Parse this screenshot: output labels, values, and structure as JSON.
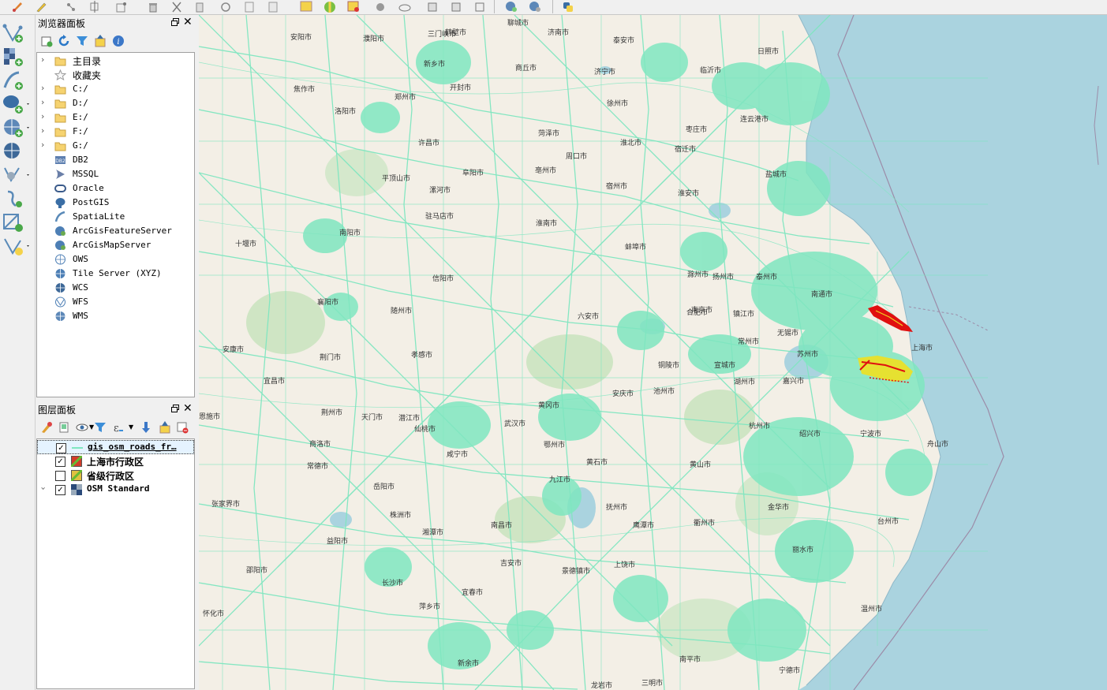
{
  "app": {
    "accent": "#7fe6c0"
  },
  "top_toolbar": {
    "icons": [
      "pencil-edit-icon",
      "pencil-icon",
      "add-feature-icon",
      "move-feature-icon",
      "node-tool-icon",
      "delete-icon",
      "cut-icon",
      "copy-icon",
      "paste-icon",
      "label-icon",
      "pie-diagram-icon",
      "layer-style-icon",
      "pin-icon",
      "show-tips-icon",
      "export-icon",
      "save-icon",
      "refresh-icon",
      "identify-icon",
      "measure-icon",
      "python-icon"
    ]
  },
  "left_toolbar": {
    "icons": [
      "add-vector-layer-icon",
      "add-raster-layer-icon",
      "add-delimited-text-icon",
      "add-postgis-icon",
      "add-wms-icon",
      "add-wcs-icon",
      "add-spatialite-icon",
      "new-temp-layer-icon",
      "add-virtual-layer-icon",
      "add-mesh-icon"
    ]
  },
  "browser_panel": {
    "title": "浏览器面板",
    "items": [
      {
        "label": "主目录",
        "icon": "folder-icon",
        "expandable": true
      },
      {
        "label": "收藏夹",
        "icon": "star-icon",
        "expandable": false
      },
      {
        "label": "C:/",
        "icon": "folder-icon",
        "expandable": true
      },
      {
        "label": "D:/",
        "icon": "folder-icon",
        "expandable": true
      },
      {
        "label": "E:/",
        "icon": "folder-icon",
        "expandable": true
      },
      {
        "label": "F:/",
        "icon": "folder-icon",
        "expandable": true
      },
      {
        "label": "G:/",
        "icon": "folder-icon",
        "expandable": true
      },
      {
        "label": "DB2",
        "icon": "db2-icon",
        "expandable": false
      },
      {
        "label": "MSSQL",
        "icon": "mssql-icon",
        "expandable": false
      },
      {
        "label": "Oracle",
        "icon": "oracle-icon",
        "expandable": false
      },
      {
        "label": "PostGIS",
        "icon": "postgis-icon",
        "expandable": false
      },
      {
        "label": "SpatiaLite",
        "icon": "spatialite-icon",
        "expandable": false
      },
      {
        "label": "ArcGisFeatureServer",
        "icon": "arcgis-feature-icon",
        "expandable": false
      },
      {
        "label": "ArcGisMapServer",
        "icon": "arcgis-map-icon",
        "expandable": false
      },
      {
        "label": "OWS",
        "icon": "ows-icon",
        "expandable": false
      },
      {
        "label": "Tile Server (XYZ)",
        "icon": "xyz-icon",
        "expandable": false
      },
      {
        "label": "WCS",
        "icon": "wcs-icon",
        "expandable": false
      },
      {
        "label": "WFS",
        "icon": "wfs-icon",
        "expandable": false
      },
      {
        "label": "WMS",
        "icon": "wms-icon",
        "expandable": false
      }
    ]
  },
  "layers_panel": {
    "title": "图层面板",
    "layers": [
      {
        "label": "gis_osm_roads_fr…",
        "checked": true,
        "symbol": "line-symbol-icon",
        "color": "#7fe6c0",
        "selected": true
      },
      {
        "label": "上海市行政区",
        "checked": true,
        "symbol": "polygon-symbol-icon",
        "color": "#d23c2a",
        "selected": false
      },
      {
        "label": "省级行政区",
        "checked": false,
        "symbol": "polygon-symbol-icon",
        "color": "#e0c040",
        "selected": false
      },
      {
        "label": "OSM Standard",
        "checked": true,
        "symbol": "raster-symbol-icon",
        "color": "#445577",
        "selected": false,
        "expanded": true
      }
    ]
  },
  "map": {
    "sea_color": "#aad3df",
    "land_color": "#f3efe6",
    "road_color": "#7fe6c0",
    "highlight_color": "#e01010",
    "places": [
      {
        "name": "鹤壁市"
      },
      {
        "name": "新乡市"
      },
      {
        "name": "开封市"
      },
      {
        "name": "郑州市"
      },
      {
        "name": "洛阳市"
      },
      {
        "name": "许昌市"
      },
      {
        "name": "平顶山市"
      },
      {
        "name": "漯河市"
      },
      {
        "name": "驻马店市"
      },
      {
        "name": "南阳市"
      },
      {
        "name": "十堰市"
      },
      {
        "name": "襄阳市"
      },
      {
        "name": "信阳市"
      },
      {
        "name": "随州市"
      },
      {
        "name": "荆门市"
      },
      {
        "name": "宜昌市"
      },
      {
        "name": "荆州市"
      },
      {
        "name": "咸宁市"
      },
      {
        "name": "岳阳市"
      },
      {
        "name": "常德市"
      },
      {
        "name": "益阳市"
      },
      {
        "name": "张家界市"
      },
      {
        "name": "长沙市"
      },
      {
        "name": "萍乡市"
      },
      {
        "name": "宜春市"
      },
      {
        "name": "南昌市"
      },
      {
        "name": "新余市"
      },
      {
        "name": "九江市"
      },
      {
        "name": "景德镇市"
      },
      {
        "name": "上饶市"
      },
      {
        "name": "黄山市"
      },
      {
        "name": "安庆市"
      },
      {
        "name": "池州市"
      },
      {
        "name": "铜陵市"
      },
      {
        "name": "宣城市"
      },
      {
        "name": "合肥市"
      },
      {
        "name": "六安市"
      },
      {
        "name": "滁州市"
      },
      {
        "name": "蚌埠市"
      },
      {
        "name": "淮南市"
      },
      {
        "name": "阜阳市"
      },
      {
        "name": "亳州市"
      },
      {
        "name": "淮北市"
      },
      {
        "name": "宿州市"
      },
      {
        "name": "徐州市"
      },
      {
        "name": "商丘市"
      },
      {
        "name": "连云港市"
      },
      {
        "name": "宿迁市"
      },
      {
        "name": "淮安市"
      },
      {
        "name": "盐城市"
      },
      {
        "name": "扬州市"
      },
      {
        "name": "泰州市"
      },
      {
        "name": "南通市"
      },
      {
        "name": "南京市"
      },
      {
        "name": "镇江市"
      },
      {
        "name": "常州市"
      },
      {
        "name": "无锡市"
      },
      {
        "name": "苏州市"
      },
      {
        "name": "上海市"
      },
      {
        "name": "湖州市"
      },
      {
        "name": "嘉兴市"
      },
      {
        "name": "杭州市"
      },
      {
        "name": "绍兴市"
      },
      {
        "name": "宁波市"
      },
      {
        "name": "舟山市"
      },
      {
        "name": "金华市"
      },
      {
        "name": "衢州市"
      },
      {
        "name": "台州市"
      },
      {
        "name": "丽水市"
      },
      {
        "name": "温州市"
      },
      {
        "name": "南平市"
      },
      {
        "name": "宁德市"
      },
      {
        "name": "日照市"
      },
      {
        "name": "临沂市"
      },
      {
        "name": "枣庄市"
      },
      {
        "name": "济宁市"
      },
      {
        "name": "菏泽市"
      },
      {
        "name": "泰安市"
      },
      {
        "name": "济南市"
      },
      {
        "name": "聊城市"
      },
      {
        "name": "濮阳市"
      },
      {
        "name": "安阳市"
      },
      {
        "name": "焦作市"
      },
      {
        "name": "周口市"
      },
      {
        "name": "武汉市"
      },
      {
        "name": "鄂州市"
      },
      {
        "name": "黄石市"
      },
      {
        "name": "黄冈市"
      },
      {
        "name": "孝感市"
      },
      {
        "name": "天门市"
      },
      {
        "name": "潜江市"
      },
      {
        "name": "仙桃市"
      },
      {
        "name": "株洲市"
      },
      {
        "name": "湘潭市"
      },
      {
        "name": "鹰潭市"
      },
      {
        "name": "抚州市"
      },
      {
        "name": "吉安市"
      },
      {
        "name": "三明市"
      },
      {
        "name": "龙岩市"
      },
      {
        "name": "三门峡市"
      },
      {
        "name": "商洛市"
      },
      {
        "name": "安康市"
      },
      {
        "name": "恩施市"
      },
      {
        "name": "怀化市"
      },
      {
        "name": "邵阳市"
      }
    ]
  }
}
